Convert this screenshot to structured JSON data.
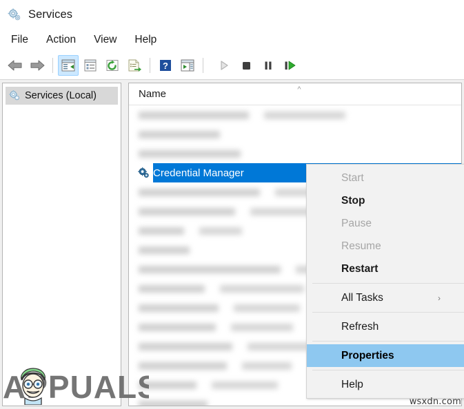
{
  "window": {
    "title": "Services",
    "icon": "services-gear-icon"
  },
  "menubar": {
    "items": [
      {
        "label": "File"
      },
      {
        "label": "Action"
      },
      {
        "label": "View"
      },
      {
        "label": "Help"
      }
    ]
  },
  "toolbar": {
    "buttons": [
      {
        "name": "back-icon",
        "state": "enabled"
      },
      {
        "name": "forward-icon",
        "state": "enabled"
      },
      {
        "name": "show-hide-console-tree-icon",
        "state": "active"
      },
      {
        "name": "properties-icon",
        "state": "enabled"
      },
      {
        "name": "refresh-icon",
        "state": "enabled"
      },
      {
        "name": "export-list-icon",
        "state": "enabled"
      },
      {
        "name": "help-icon",
        "state": "enabled"
      },
      {
        "name": "show-hide-action-pane-icon",
        "state": "enabled"
      },
      {
        "name": "start-service-icon",
        "state": "disabled"
      },
      {
        "name": "stop-service-icon",
        "state": "enabled"
      },
      {
        "name": "pause-service-icon",
        "state": "enabled"
      },
      {
        "name": "restart-service-icon",
        "state": "enabled"
      }
    ]
  },
  "tree": {
    "nodes": [
      {
        "label": "Services (Local)",
        "icon": "services-gear-icon",
        "selected": true
      }
    ]
  },
  "list": {
    "columns": [
      {
        "label": "Name"
      }
    ],
    "sort_indicator": "ascending-chevron",
    "selected_row": {
      "label": "Credential Manager",
      "icon": "services-gear-icon"
    },
    "obscured_rows_above": [
      {
        "w1": 160,
        "w2": 118
      },
      {
        "w1": 118,
        "w2": 0
      },
      {
        "w1": 148,
        "w2": 0
      }
    ],
    "obscured_rows_below": [
      {
        "w1": 176,
        "w2": 84
      },
      {
        "w1": 140,
        "w2": 108
      },
      {
        "w1": 66,
        "w2": 62
      },
      {
        "w1": 74,
        "w2": 0
      },
      {
        "w1": 206,
        "w2": 88
      },
      {
        "w1": 96,
        "w2": 122
      },
      {
        "w1": 116,
        "w2": 96
      },
      {
        "w1": 112,
        "w2": 90
      },
      {
        "w1": 136,
        "w2": 112
      },
      {
        "w1": 128,
        "w2": 72
      },
      {
        "w1": 84,
        "w2": 96
      },
      {
        "w1": 100,
        "w2": 0
      }
    ]
  },
  "context_menu": {
    "items": [
      {
        "label": "Start",
        "state": "disabled",
        "type": "item"
      },
      {
        "label": "Stop",
        "state": "enabled",
        "type": "item",
        "bold": true
      },
      {
        "label": "Pause",
        "state": "disabled",
        "type": "item"
      },
      {
        "label": "Resume",
        "state": "disabled",
        "type": "item"
      },
      {
        "label": "Restart",
        "state": "enabled",
        "type": "item",
        "bold": true
      },
      {
        "type": "separator"
      },
      {
        "label": "All Tasks",
        "state": "enabled",
        "type": "submenu",
        "arrow": "›"
      },
      {
        "type": "separator"
      },
      {
        "label": "Refresh",
        "state": "enabled",
        "type": "item"
      },
      {
        "type": "separator"
      },
      {
        "label": "Properties",
        "state": "enabled",
        "type": "item",
        "highlighted": true
      },
      {
        "type": "separator"
      },
      {
        "label": "Help",
        "state": "enabled",
        "type": "item"
      }
    ]
  },
  "watermarks": {
    "brand": "APPUALS",
    "site": "wsxdn.com"
  },
  "colors": {
    "selection_blue": "#0078d7",
    "menu_highlight": "#8ec8f0",
    "toolbar_active": "#cce8ff",
    "tree_selected": "#d8d8d8"
  }
}
